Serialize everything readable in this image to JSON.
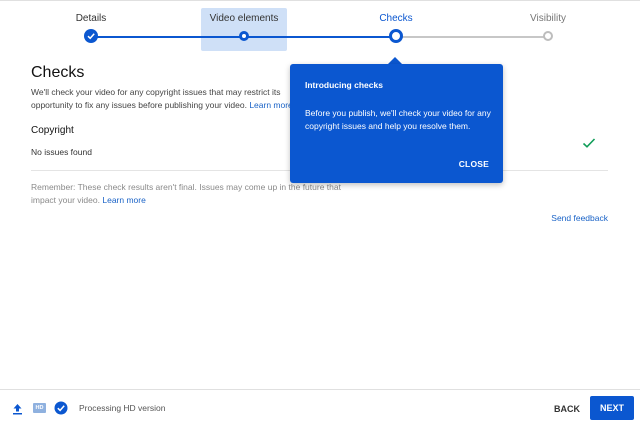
{
  "stepper": {
    "steps": [
      {
        "label": "Details",
        "state": "done"
      },
      {
        "label": "Video elements",
        "state": "current-visited"
      },
      {
        "label": "Checks",
        "state": "active"
      },
      {
        "label": "Visibility",
        "state": "pending"
      }
    ]
  },
  "page": {
    "title": "Checks",
    "description_line1": "We'll check your video for any copyright issues that may restrict its",
    "description_line2": "opportunity to fix any issues before publishing your video.",
    "description_link": "Learn more"
  },
  "copyright": {
    "label": "Copyright",
    "status": "No issues found"
  },
  "reminder": {
    "text": "Remember: These check results aren't final. Issues may come up in the future that impact your video.",
    "link": "Learn more"
  },
  "feedback": {
    "label": "Send feedback"
  },
  "tooltip": {
    "title": "Introducing checks",
    "body": "Before you publish, we'll check your video for any copyright issues and help you resolve them.",
    "close_label": "CLOSE"
  },
  "footer": {
    "hd_badge": "HD",
    "processing_text": "Processing HD version",
    "back_label": "BACK",
    "next_label": "NEXT"
  },
  "colors": {
    "accent": "#0b57d0",
    "highlight": "#cfe0f7",
    "success": "#0f9d58",
    "link": "#1a63c7"
  }
}
